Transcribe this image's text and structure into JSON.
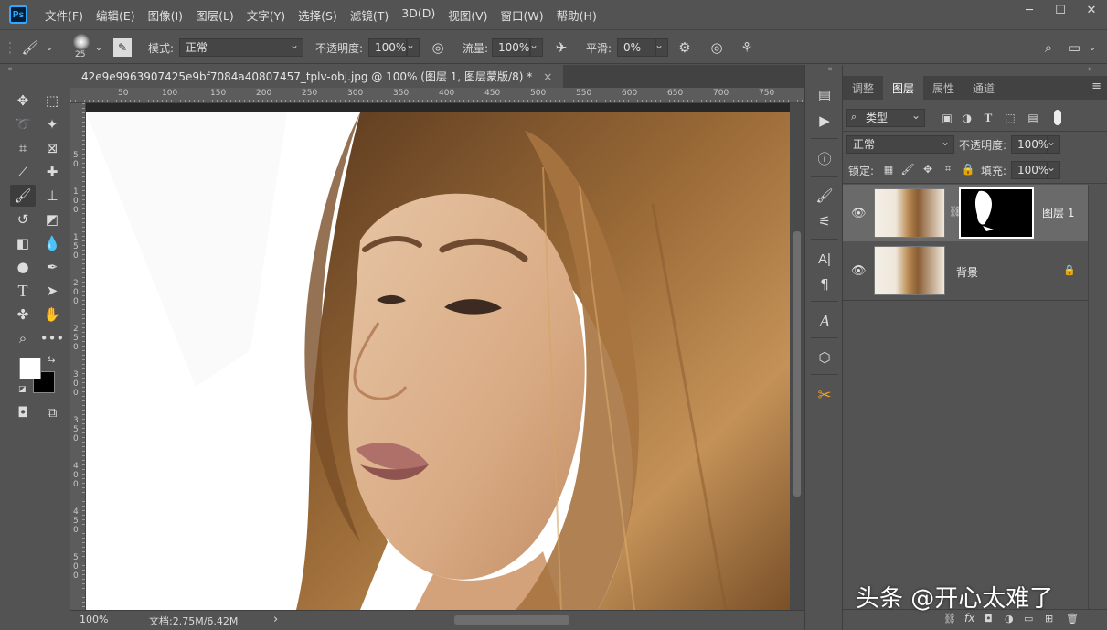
{
  "app": {
    "logo": "Ps"
  },
  "menu": [
    "文件(F)",
    "编辑(E)",
    "图像(I)",
    "图层(L)",
    "文字(Y)",
    "选择(S)",
    "滤镜(T)",
    "3D(D)",
    "视图(V)",
    "窗口(W)",
    "帮助(H)"
  ],
  "window_controls": {
    "minimize": "─",
    "maximize": "☐",
    "close": "✕"
  },
  "options": {
    "brush_size": "25",
    "mode_label": "模式:",
    "mode_value": "正常",
    "opacity_label": "不透明度:",
    "opacity_value": "100%",
    "flow_label": "流量:",
    "flow_value": "100%",
    "smooth_label": "平滑:",
    "smooth_value": "0%"
  },
  "document": {
    "tab_title": "42e9e9963907425e9bf7084a40807457_tplv-obj.jpg @ 100% (图层 1, 图层蒙版/8) *",
    "close": "×"
  },
  "ruler_top": [
    "50",
    "100",
    "150",
    "200",
    "250",
    "300",
    "350",
    "400",
    "450",
    "500",
    "550",
    "600",
    "650",
    "700",
    "750"
  ],
  "ruler_left": [
    "5",
    "0",
    "1",
    "0",
    "0",
    "1",
    "5",
    "0",
    "2",
    "0",
    "0",
    "2",
    "5",
    "0",
    "3",
    "0",
    "0",
    "3",
    "5",
    "0",
    "4",
    "0",
    "0",
    "4",
    "5",
    "0",
    "5",
    "0",
    "0"
  ],
  "status": {
    "zoom": "100%",
    "doc_info": "文档:2.75M/6.42M",
    "arrow": "›"
  },
  "panel": {
    "tabs": [
      "调整",
      "图层",
      "属性",
      "通道"
    ],
    "active_tab": "图层",
    "filter_kind": "类型",
    "blend_mode": "正常",
    "opacity_label": "不透明度:",
    "opacity_value": "100%",
    "lock_label": "锁定:",
    "fill_label": "填充:",
    "fill_value": "100%",
    "layers": [
      {
        "name": "图层 1",
        "has_mask": true,
        "selected": true
      },
      {
        "name": "背景",
        "has_mask": false,
        "locked": true
      }
    ],
    "bottom_fx": "fx"
  },
  "watermark": "头条 @开心太难了"
}
